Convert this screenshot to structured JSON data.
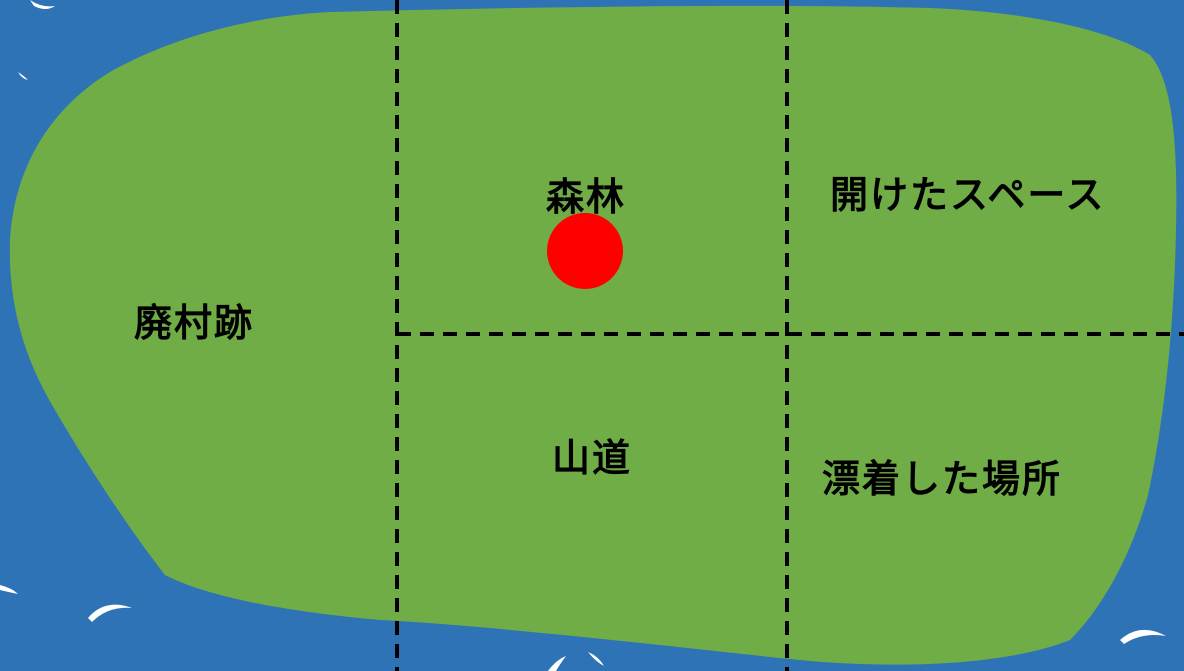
{
  "colors": {
    "sea": "#2e73b5",
    "land": "#70ad47",
    "grid_line": "#000000",
    "marker": "#ff0000",
    "wave": "#ffffff"
  },
  "regions": {
    "abandoned_village": "廃村跡",
    "forest": "森林",
    "open_space": "開けたスペース",
    "mountain_trail": "山道",
    "drift_ashore": "漂着した場所"
  },
  "marker": {
    "region": "forest",
    "shape": "circle"
  }
}
